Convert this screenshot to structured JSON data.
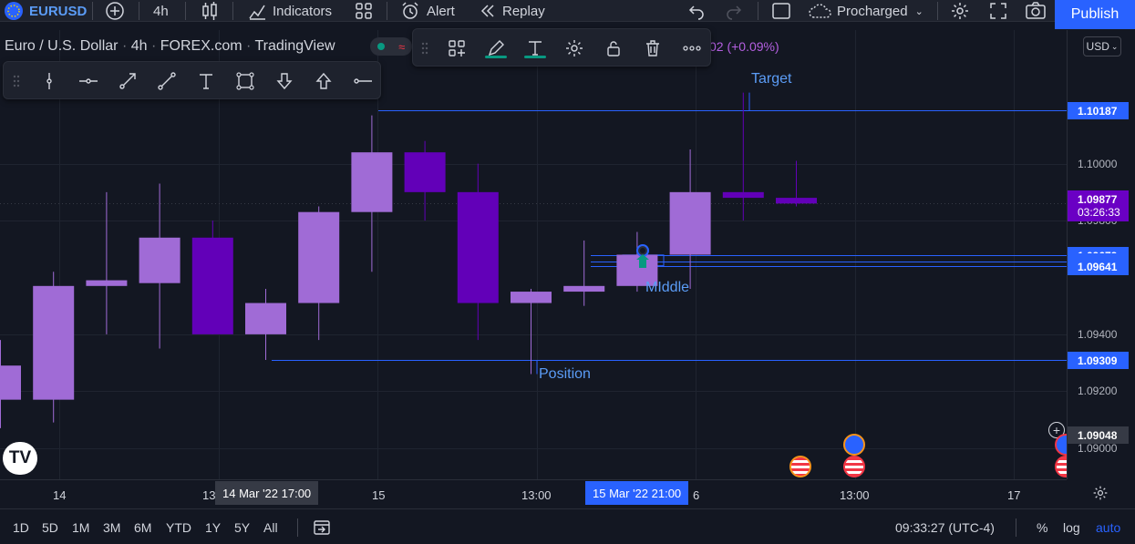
{
  "toolbar": {
    "symbol": "EURUSD",
    "interval": "4h",
    "indicators_label": "Indicators",
    "alert_label": "Alert",
    "replay_label": "Replay",
    "layout_name": "Procharged",
    "publish_label": "Publish"
  },
  "legend": {
    "symbol_name": "Euro / U.S. Dollar",
    "interval": "4h",
    "exchange": "FOREX.com",
    "source": "TradingView",
    "change_text": "02 (+0.09%)"
  },
  "currency_button": "USD",
  "price_axis": {
    "ticks": [
      "1.10000",
      "1.09400",
      "1.09200",
      "1.09000"
    ],
    "partial_ticks": [
      "1.09800"
    ],
    "tags": [
      {
        "value": "1.10187",
        "color": "#2962ff"
      },
      {
        "value": "1.09679",
        "color": "#2962ff"
      },
      {
        "value": "1.09657",
        "color": "#2962ff"
      },
      {
        "value": "1.09641",
        "color": "#2962ff"
      },
      {
        "value": "1.09309",
        "color": "#2962ff"
      },
      {
        "value": "1.09048",
        "color": "#363a45"
      }
    ],
    "last_price": {
      "value": "1.09877",
      "countdown": "03:26:33",
      "color": "#6a00c4"
    }
  },
  "time_axis": {
    "labels": [
      "14",
      "13",
      "15",
      "13:00",
      "6",
      "13:00",
      "17"
    ],
    "crosshair_tag": "14 Mar '22   17:00",
    "selected_tag": "15 Mar '22   21:00"
  },
  "drawings": {
    "target_label": "Target",
    "middle_label": "MIddle",
    "position_label": "Position"
  },
  "bottom_bar": {
    "ranges": [
      "1D",
      "5D",
      "1M",
      "3M",
      "6M",
      "YTD",
      "1Y",
      "5Y",
      "All"
    ],
    "clock": "09:33:27 (UTC-4)",
    "percent_label": "%",
    "log_label": "log",
    "auto_label": "auto"
  },
  "colors": {
    "background": "#131722",
    "bull_candle": "#a06bd6",
    "bear_candle": "#6200b8",
    "line_blue": "#2962ff",
    "accent_green": "#089981"
  },
  "chart_data": {
    "type": "candlestick",
    "symbol": "EURUSD",
    "interval": "4h",
    "ylim": [
      1.0889,
      1.1047
    ],
    "candles": [
      {
        "o": 1.0917,
        "h": 1.0938,
        "l": 1.0907,
        "c": 1.0929
      },
      {
        "o": 1.0917,
        "h": 1.0962,
        "l": 1.0909,
        "c": 1.0957
      },
      {
        "o": 1.0957,
        "h": 1.099,
        "l": 1.094,
        "c": 1.0959
      },
      {
        "o": 1.0958,
        "h": 1.0993,
        "l": 1.0935,
        "c": 1.0974
      },
      {
        "o": 1.0974,
        "h": 1.098,
        "l": 1.094,
        "c": 1.094
      },
      {
        "o": 1.094,
        "h": 1.0956,
        "l": 1.0931,
        "c": 1.0951
      },
      {
        "o": 1.0951,
        "h": 1.0985,
        "l": 1.0938,
        "c": 1.0983
      },
      {
        "o": 1.0983,
        "h": 1.1017,
        "l": 1.0962,
        "c": 1.1004
      },
      {
        "o": 1.1004,
        "h": 1.1008,
        "l": 1.098,
        "c": 1.099
      },
      {
        "o": 1.099,
        "h": 1.1,
        "l": 1.0938,
        "c": 1.0951
      },
      {
        "o": 1.0951,
        "h": 1.0956,
        "l": 1.0926,
        "c": 1.0955
      },
      {
        "o": 1.0955,
        "h": 1.0973,
        "l": 1.095,
        "c": 1.0957
      },
      {
        "o": 1.0957,
        "h": 1.0976,
        "l": 1.0955,
        "c": 1.0968
      },
      {
        "o": 1.0968,
        "h": 1.1005,
        "l": 1.0956,
        "c": 1.099
      },
      {
        "o": 1.099,
        "h": 1.1025,
        "l": 1.098,
        "c": 1.0988
      },
      {
        "o": 1.0988,
        "h": 1.1001,
        "l": 1.0985,
        "c": 1.0986
      }
    ],
    "horizontal_lines": [
      1.10187,
      1.09679,
      1.09657,
      1.09641,
      1.09309
    ],
    "xlabel": "",
    "ylabel": ""
  }
}
